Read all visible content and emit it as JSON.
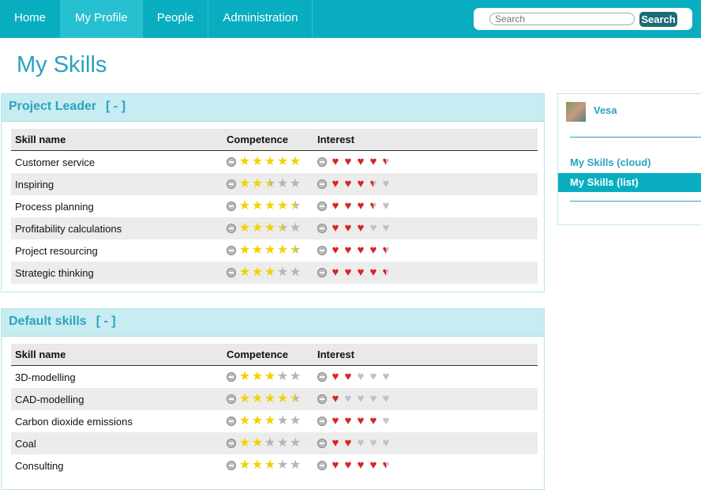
{
  "nav": {
    "items": [
      {
        "label": "Home"
      },
      {
        "label": "My Profile"
      },
      {
        "label": "People"
      },
      {
        "label": "Administration"
      }
    ]
  },
  "search": {
    "placeholder": "Search",
    "button_label": "Search"
  },
  "page": {
    "title": "My Skills"
  },
  "sections": [
    {
      "title": "Project Leader",
      "toggle": "[ - ]",
      "headers": {
        "name": "Skill name",
        "competence": "Competence",
        "interest": "Interest"
      },
      "rows": [
        {
          "name": "Customer service",
          "competence": 5,
          "interest": 4.5
        },
        {
          "name": "Inspiring",
          "competence": 2.5,
          "interest": 3.5
        },
        {
          "name": "Process planning",
          "competence": 4.5,
          "interest": 3.5
        },
        {
          "name": "Profitability calculations",
          "competence": 3.5,
          "interest": 3
        },
        {
          "name": "Project resourcing",
          "competence": 4.5,
          "interest": 4.5
        },
        {
          "name": "Strategic thinking",
          "competence": 3,
          "interest": 4.5
        }
      ]
    },
    {
      "title": "Default skills",
      "toggle": "[ - ]",
      "headers": {
        "name": "Skill name",
        "competence": "Competence",
        "interest": "Interest"
      },
      "rows": [
        {
          "name": "3D-modelling",
          "competence": 3,
          "interest": 2
        },
        {
          "name": "CAD-modelling",
          "competence": 4.5,
          "interest": 1
        },
        {
          "name": "Carbon dioxide emissions",
          "competence": 3,
          "interest": 4
        },
        {
          "name": "Coal",
          "competence": 2,
          "interest": 2
        },
        {
          "name": "Consulting",
          "competence": 3,
          "interest": 4.5
        }
      ]
    }
  ],
  "sidebar": {
    "user": {
      "name": "Vesa"
    },
    "links": [
      {
        "label": "My Skills (cloud)",
        "active": false
      },
      {
        "label": "My Skills (list)",
        "active": true
      }
    ]
  },
  "colors": {
    "accent": "#08aec0",
    "title": "#2aa3bf",
    "star": "#f2d200",
    "heart": "#d82424"
  }
}
